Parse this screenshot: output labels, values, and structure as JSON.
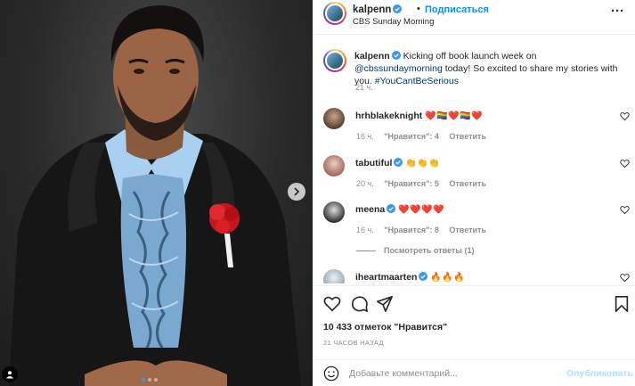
{
  "post": {
    "username": "kalpenn",
    "follow_label": "Подписаться",
    "separator": "•",
    "location": "CBS Sunday Morning",
    "more_label": "···",
    "photo_icons": {
      "next": "chevron-right-icon",
      "tag": "user-tag-icon"
    }
  },
  "caption": {
    "username": "kalpenn",
    "text_before": " Kicking off book launch week on ",
    "mention": "@cbssundaymorning",
    "text_after": " today! So excited to share my stories with you. ",
    "hashtag": "#YouCantBeSerious",
    "time": "21 ч."
  },
  "comments": [
    {
      "username": "hrhblakeknight",
      "text": "❤️🏳️‍🌈❤️🏳️‍🌈❤️",
      "time": "16 ч.",
      "likes": "\"Нравится\": 4",
      "reply": "Ответить",
      "verified": false
    },
    {
      "username": "tabutiful",
      "text": "👏👏👏",
      "time": "20 ч.",
      "likes": "\"Нравится\": 5",
      "reply": "Ответить",
      "verified": true
    },
    {
      "username": "meena",
      "text": "❤️❤️❤️❤️",
      "time": "16 ч.",
      "likes": "\"Нравится\": 8",
      "reply": "Ответить",
      "verified": true
    },
    {
      "username": "iheartmaarten",
      "text": "🔥🔥🔥",
      "time": "",
      "likes": "",
      "reply": "",
      "verified": true
    }
  ],
  "view_replies": "Посмотреть ответы (1)",
  "footer": {
    "likes_count": "10 433 отметок \"Нравится\"",
    "time_ago": "21 ЧАСОВ НАЗАД",
    "comment_placeholder": "Добавьте комментарий...",
    "publish_label": "Опубликовать"
  },
  "colors": {
    "accent": "#0095f6",
    "verified": "#3897f0",
    "muted": "#8e8e8e",
    "rose": "#d8171f"
  }
}
